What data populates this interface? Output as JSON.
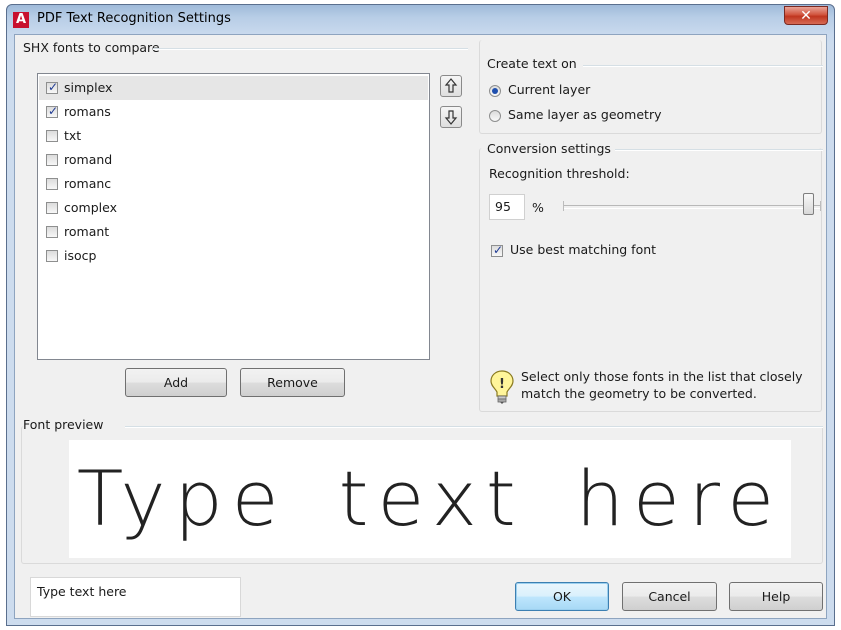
{
  "window": {
    "app_logo": "A",
    "title": "PDF Text Recognition Settings",
    "close_symbol": "✕"
  },
  "fonts_group": {
    "label": "SHX fonts to compare",
    "items": [
      {
        "label": "simplex",
        "checked": true,
        "selected": true
      },
      {
        "label": "romans",
        "checked": true,
        "selected": false
      },
      {
        "label": "txt",
        "checked": false,
        "selected": false
      },
      {
        "label": "romand",
        "checked": false,
        "selected": false
      },
      {
        "label": "romanc",
        "checked": false,
        "selected": false
      },
      {
        "label": "complex",
        "checked": false,
        "selected": false
      },
      {
        "label": "romant",
        "checked": false,
        "selected": false
      },
      {
        "label": "isocp",
        "checked": false,
        "selected": false
      }
    ],
    "move_up_icon": "arrow-up-outline-icon",
    "move_down_icon": "arrow-down-outline-icon",
    "add_label": "Add",
    "remove_label": "Remove"
  },
  "create_text_group": {
    "label": "Create text on",
    "options": [
      {
        "label": "Current layer",
        "selected": true
      },
      {
        "label": "Same layer as geometry",
        "selected": false
      }
    ]
  },
  "conversion_group": {
    "label": "Conversion settings",
    "threshold_label": "Recognition threshold:",
    "threshold_value": "95",
    "threshold_unit": "%",
    "slider_fraction": 0.95,
    "best_match_label": "Use best matching font",
    "best_match_checked": true,
    "tip_icon": "lightbulb-icon",
    "tip_text": "Select only those fonts in the list that closely match the geometry to be converted."
  },
  "preview_group": {
    "label": "Font preview",
    "preview_text": "Type text here",
    "input_value": "Type text here"
  },
  "buttons": {
    "ok": "OK",
    "cancel": "Cancel",
    "help": "Help"
  },
  "colors": {
    "logo_red": "#c8102e",
    "dialog_bg": "#f0f0f0",
    "check_mark": "#1f3a93",
    "selection": "#e6e6e6"
  }
}
